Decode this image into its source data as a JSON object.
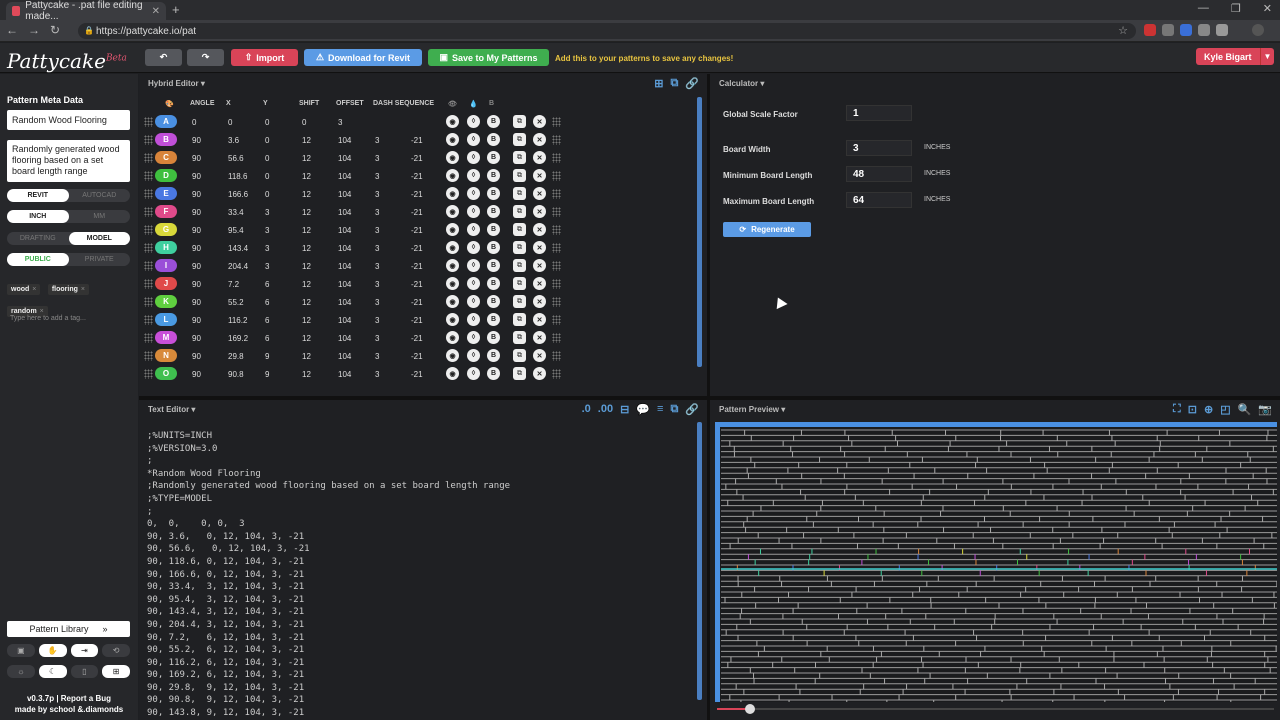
{
  "browser": {
    "tab_title": "Pattycake - .pat file editing made...",
    "url": "https://pattycake.io/pat"
  },
  "app": {
    "logo": "Pattycake",
    "logo_badge": "Beta",
    "toolbar": {
      "import_label": "Import",
      "download_label": "Download for Revit",
      "save_label": "Save to My Patterns",
      "warning": "Add this to your patterns to save any changes!"
    },
    "user": "Kyle Bigart"
  },
  "sidebar": {
    "title": "Pattern Meta Data",
    "name_value": "Random Wood Flooring",
    "description": "Randomly generated wood flooring based on a set board length range",
    "toggles": [
      {
        "a": "REVIT",
        "b": "AUTOCAD",
        "on": "a"
      },
      {
        "a": "INCH",
        "b": "MM",
        "on": "a"
      },
      {
        "a": "DRAFTING",
        "b": "MODEL",
        "on": "b"
      },
      {
        "a": "PUBLIC",
        "b": "PRIVATE",
        "on": "a"
      }
    ],
    "tags": [
      "wood",
      "flooring",
      "random"
    ],
    "tag_placeholder": "Type here to add a tag...",
    "library_label": "Pattern Library",
    "version": "v0.3.7p | Report a Bug",
    "credit": "made by school &.diamonds"
  },
  "hybrid_editor": {
    "title": "Hybrid Editor",
    "columns": [
      "ANGLE",
      "X",
      "Y",
      "SHIFT",
      "OFFSET",
      "DASH SEQUENCE"
    ],
    "rows": [
      {
        "letter": "A",
        "color": "#4a90e2",
        "angle": "0",
        "x": "0",
        "y": "0",
        "shift": "0",
        "offset": "3",
        "d1": "",
        "d2": ""
      },
      {
        "letter": "B",
        "color": "#c04fd8",
        "angle": "90",
        "x": "3.6",
        "y": "0",
        "shift": "12",
        "offset": "104",
        "d1": "3",
        "d2": "-21"
      },
      {
        "letter": "C",
        "color": "#d8843a",
        "angle": "90",
        "x": "56.6",
        "y": "0",
        "shift": "12",
        "offset": "104",
        "d1": "3",
        "d2": "-21"
      },
      {
        "letter": "D",
        "color": "#3fbf3f",
        "angle": "90",
        "x": "118.6",
        "y": "0",
        "shift": "12",
        "offset": "104",
        "d1": "3",
        "d2": "-21"
      },
      {
        "letter": "E",
        "color": "#4a78e2",
        "angle": "90",
        "x": "166.6",
        "y": "0",
        "shift": "12",
        "offset": "104",
        "d1": "3",
        "d2": "-21"
      },
      {
        "letter": "F",
        "color": "#e04a8a",
        "angle": "90",
        "x": "33.4",
        "y": "3",
        "shift": "12",
        "offset": "104",
        "d1": "3",
        "d2": "-21"
      },
      {
        "letter": "G",
        "color": "#d8d83a",
        "angle": "90",
        "x": "95.4",
        "y": "3",
        "shift": "12",
        "offset": "104",
        "d1": "3",
        "d2": "-21"
      },
      {
        "letter": "H",
        "color": "#3fcf9f",
        "angle": "90",
        "x": "143.4",
        "y": "3",
        "shift": "12",
        "offset": "104",
        "d1": "3",
        "d2": "-21"
      },
      {
        "letter": "I",
        "color": "#9a4fd8",
        "angle": "90",
        "x": "204.4",
        "y": "3",
        "shift": "12",
        "offset": "104",
        "d1": "3",
        "d2": "-21"
      },
      {
        "letter": "J",
        "color": "#e04a4a",
        "angle": "90",
        "x": "7.2",
        "y": "6",
        "shift": "12",
        "offset": "104",
        "d1": "3",
        "d2": "-21"
      },
      {
        "letter": "K",
        "color": "#5fcf3f",
        "angle": "90",
        "x": "55.2",
        "y": "6",
        "shift": "12",
        "offset": "104",
        "d1": "3",
        "d2": "-21"
      },
      {
        "letter": "L",
        "color": "#4a9ae2",
        "angle": "90",
        "x": "116.2",
        "y": "6",
        "shift": "12",
        "offset": "104",
        "d1": "3",
        "d2": "-21"
      },
      {
        "letter": "M",
        "color": "#c84fd8",
        "angle": "90",
        "x": "169.2",
        "y": "6",
        "shift": "12",
        "offset": "104",
        "d1": "3",
        "d2": "-21"
      },
      {
        "letter": "N",
        "color": "#d88a3a",
        "angle": "90",
        "x": "29.8",
        "y": "9",
        "shift": "12",
        "offset": "104",
        "d1": "3",
        "d2": "-21"
      },
      {
        "letter": "O",
        "color": "#3fbf4f",
        "angle": "90",
        "x": "90.8",
        "y": "9",
        "shift": "12",
        "offset": "104",
        "d1": "3",
        "d2": "-21"
      }
    ]
  },
  "calculator": {
    "title": "Calculator",
    "fields": [
      {
        "label": "Global Scale Factor",
        "value": "1",
        "unit": ""
      },
      {
        "label": "Board Width",
        "value": "3",
        "unit": "INCHES"
      },
      {
        "label": "Minimum Board Length",
        "value": "48",
        "unit": "INCHES"
      },
      {
        "label": "Maximum Board Length",
        "value": "64",
        "unit": "INCHES"
      }
    ],
    "regenerate_label": "Regenerate"
  },
  "text_editor": {
    "title": "Text Editor",
    "content": ";%UNITS=INCH\n;%VERSION=3.0\n;\n*Random Wood Flooring\n;Randomly generated wood flooring based on a set board length range\n;%TYPE=MODEL\n;\n0,  0,    0, 0,  3\n90, 3.6,   0, 12, 104, 3, -21\n90, 56.6,   0, 12, 104, 3, -21\n90, 118.6, 0, 12, 104, 3, -21\n90, 166.6, 0, 12, 104, 3, -21\n90, 33.4,  3, 12, 104, 3, -21\n90, 95.4,  3, 12, 104, 3, -21\n90, 143.4, 3, 12, 104, 3, -21\n90, 204.4, 3, 12, 104, 3, -21\n90, 7.2,   6, 12, 104, 3, -21\n90, 55.2,  6, 12, 104, 3, -21\n90, 116.2, 6, 12, 104, 3, -21\n90, 169.2, 6, 12, 104, 3, -21\n90, 29.8,  9, 12, 104, 3, -21\n90, 90.8,  9, 12, 104, 3, -21\n90, 143.8, 9, 12, 104, 3, -21"
  },
  "preview": {
    "title": "Pattern Preview"
  }
}
